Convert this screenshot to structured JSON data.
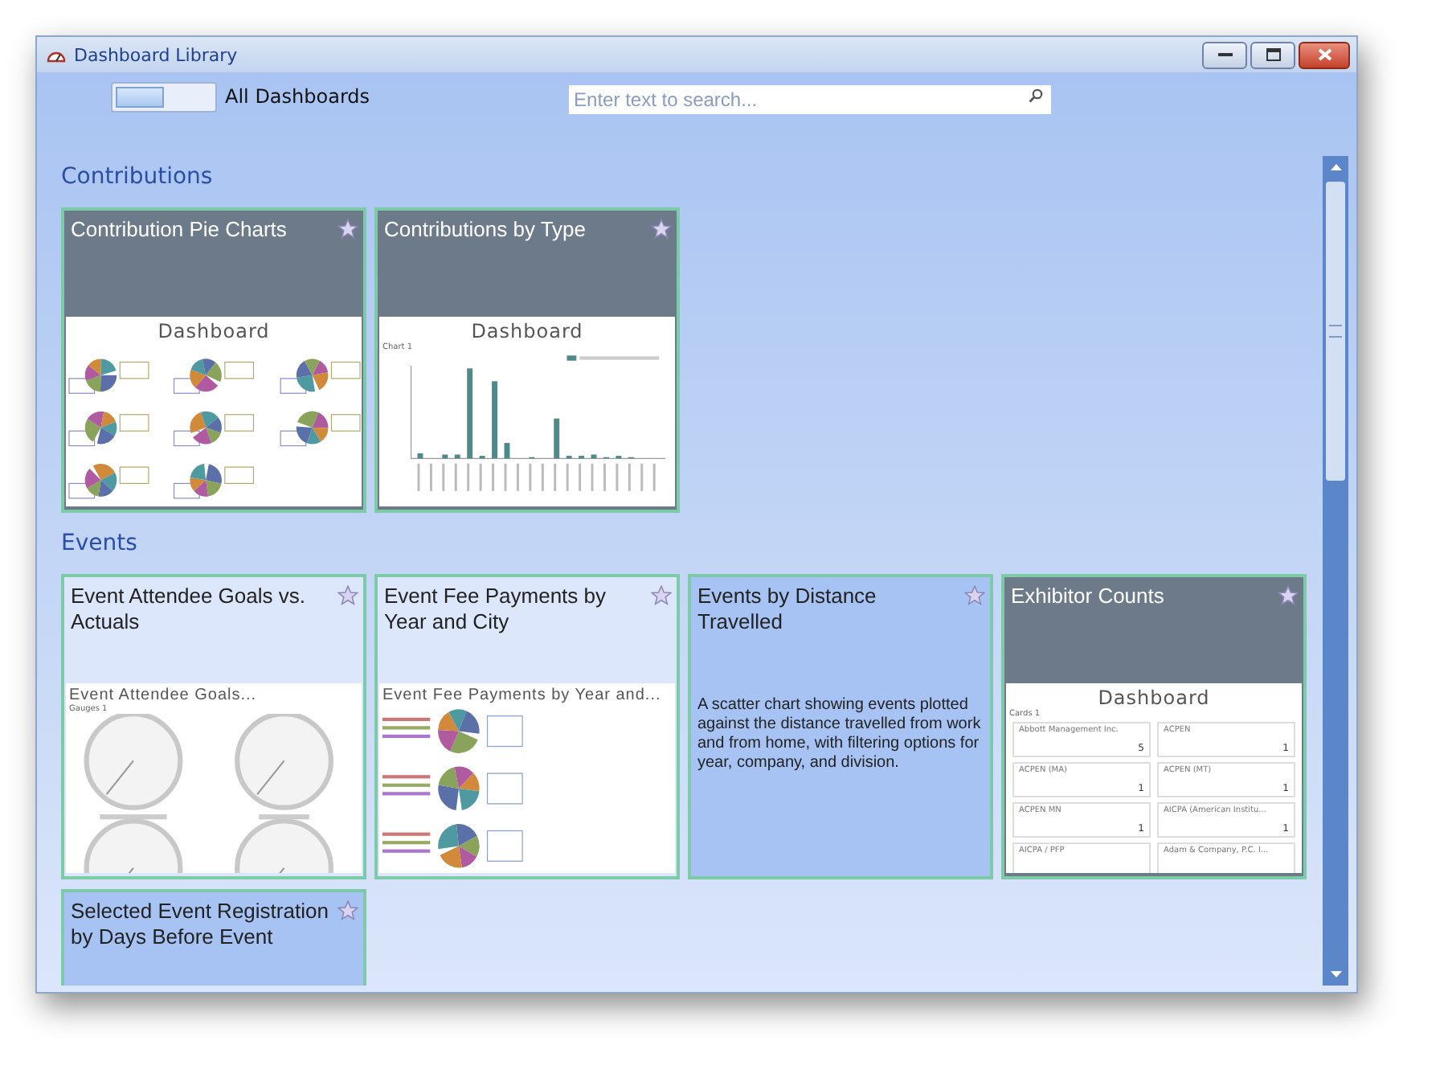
{
  "window": {
    "title": "Dashboard Library"
  },
  "filter": {
    "label": "All Dashboards"
  },
  "search": {
    "placeholder": "Enter text to search..."
  },
  "sections": [
    {
      "heading": "Contributions",
      "tiles": [
        {
          "title": "Contribution Pie Charts",
          "kind": "dark",
          "preview": {
            "kind": "pies",
            "title": "Dashboard"
          }
        },
        {
          "title": "Contributions by Type",
          "kind": "dark",
          "preview": {
            "kind": "bars",
            "title": "Dashboard",
            "subtitle": "Chart 1"
          }
        }
      ]
    },
    {
      "heading": "Events",
      "tiles": [
        {
          "title": "Event Attendee Goals vs. Actuals",
          "kind": "light",
          "preview": {
            "kind": "gauges",
            "title": "Event Attendee Goals...",
            "subtitle": "Gauges 1"
          }
        },
        {
          "title": "Event Fee Payments by Year and City",
          "kind": "light",
          "preview": {
            "kind": "pies-stacked",
            "title": "Event Fee Payments by Year and..."
          }
        },
        {
          "title": "Events by Distance Travelled",
          "kind": "described",
          "description": "A scatter chart showing events plotted against the distance travelled from work and from home, with filtering options for year, company, and division."
        },
        {
          "title": "Exhibitor Counts",
          "kind": "dark",
          "preview": {
            "kind": "cards",
            "title": "Dashboard",
            "subtitle": "Cards 1",
            "cards": [
              {
                "name": "Abbott Management Inc.",
                "count": "5"
              },
              {
                "name": "ACPEN",
                "count": "1"
              },
              {
                "name": "ACPEN (MA)",
                "count": "1"
              },
              {
                "name": "ACPEN (MT)",
                "count": "1"
              },
              {
                "name": "ACPEN MN",
                "count": "1"
              },
              {
                "name": "AICPA (American Institu...",
                "count": "1"
              },
              {
                "name": "AICPA / PFP"
              },
              {
                "name": "Adam & Company, P.C. I..."
              }
            ]
          }
        },
        {
          "title": "Selected Event Registration by Days Before Event",
          "kind": "described"
        }
      ]
    }
  ]
}
